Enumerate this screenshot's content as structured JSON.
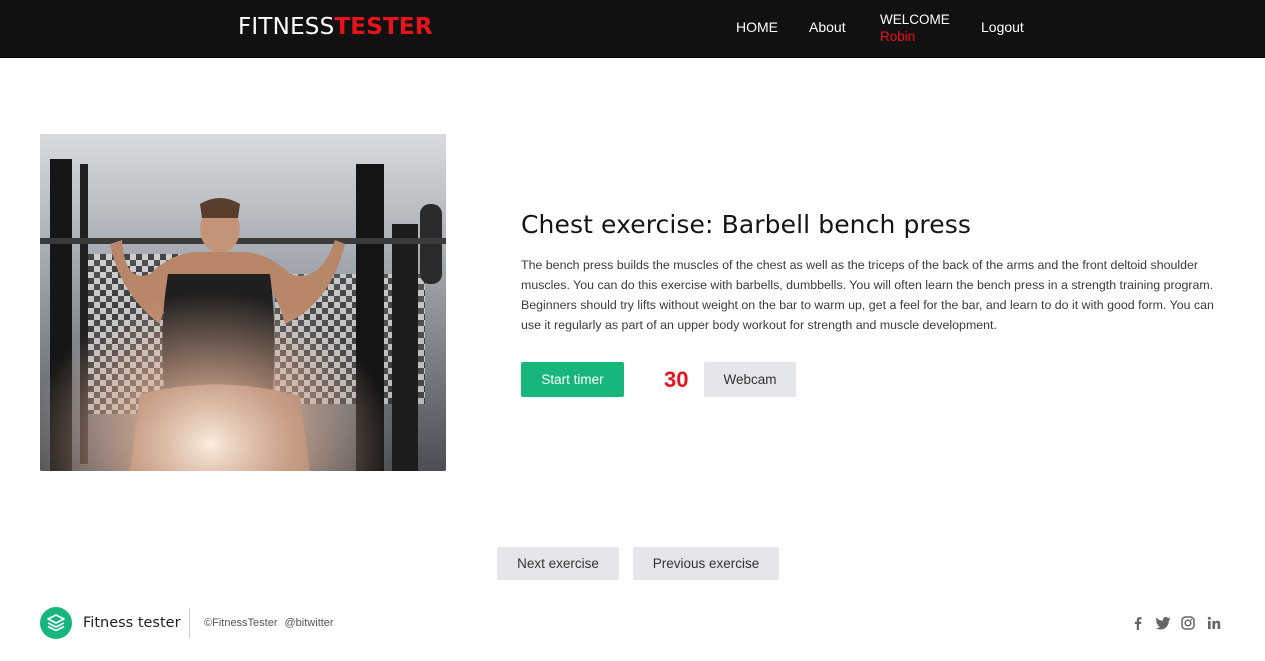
{
  "header": {
    "logo_part1": "FITNESS",
    "logo_part2": "TESTER",
    "nav": {
      "home": "HOME",
      "about": "About",
      "welcome": "WELCOME",
      "username": "Robin",
      "logout": "Logout"
    }
  },
  "exercise": {
    "title": "Chest exercise: Barbell bench press",
    "description": "The bench press builds the muscles of the chest as well as the triceps of the back of the arms and the front deltoid shoulder muscles. You can do this exercise with barbells, dumbbells. You will often learn the bench press in a strength training program. Beginners should try lifts without weight on the bar to warm up, get a feel for the bar, and learn to do it with good form. You can use it regularly as part of an upper body workout for strength and muscle development.",
    "start_timer_label": "Start timer",
    "timer_value": "30",
    "webcam_label": "Webcam"
  },
  "navigation": {
    "next_label": "Next exercise",
    "previous_label": "Previous exercise"
  },
  "footer": {
    "brand": "Fitness tester",
    "copyright": "©FitnessTester",
    "twitter_handle": "@bitwitter",
    "social_icons": [
      "facebook-icon",
      "twitter-icon",
      "instagram-icon",
      "linkedin-icon"
    ]
  },
  "colors": {
    "accent_red": "#e8131a",
    "accent_green": "#17b77c",
    "nav_background": "#111111"
  }
}
